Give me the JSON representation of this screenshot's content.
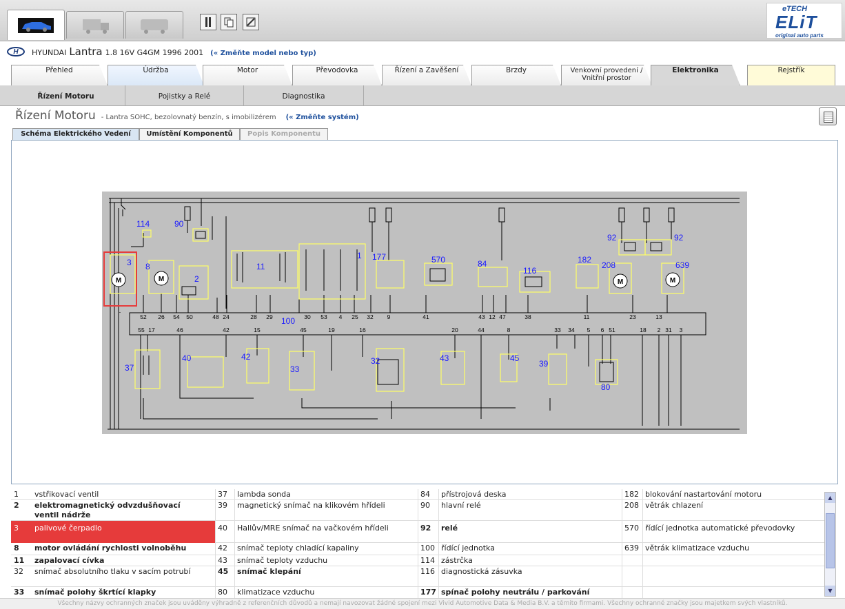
{
  "brand": {
    "top": "eTECH",
    "name": "ELiT",
    "tagline": "original auto parts"
  },
  "vehicle": {
    "make": "HYUNDAI",
    "model": "Lantra",
    "spec": "1.8 16V G4GM 1996 2001",
    "change_link": "(« Změňte model nebo typ)"
  },
  "main_tabs": [
    {
      "label": "Přehled"
    },
    {
      "label": "Údržba"
    },
    {
      "label": "Motor"
    },
    {
      "label": "Převodovka"
    },
    {
      "label": "Řízení a Zavěšení"
    },
    {
      "label": "Brzdy"
    },
    {
      "label": "Venkovní provedení / Vnitřní prostor"
    },
    {
      "label": "Elektronika"
    },
    {
      "label": "Rejstřík"
    }
  ],
  "sub_tabs": [
    {
      "label": "Řízení Motoru"
    },
    {
      "label": "Pojistky a Relé"
    },
    {
      "label": "Diagnostika"
    }
  ],
  "system": {
    "title": "Řízení Motoru",
    "desc": "- Lantra SOHC, bezolovnatý benzín, s imobilizérem",
    "change_link": "(« Změňte systém)"
  },
  "inner_tabs": [
    {
      "label": "Schéma Elektrického Vedení"
    },
    {
      "label": "Umístění Komponentů"
    },
    {
      "label": "Popis Komponentu"
    }
  ],
  "diagram_labels": {
    "c114": "114",
    "c90": "90",
    "c3": "3",
    "c8": "8",
    "c2": "2",
    "c11": "11",
    "c1": "1",
    "c177": "177",
    "c570": "570",
    "c84": "84",
    "c116": "116",
    "c182": "182",
    "c92a": "92",
    "c92b": "92",
    "c208": "208",
    "c639": "639",
    "c100": "100",
    "c37": "37",
    "c40": "40",
    "c42": "42",
    "c33": "33",
    "c32": "32",
    "c43": "43",
    "c45": "45",
    "c39": "39",
    "c80": "80"
  },
  "pins": {
    "p52": "52",
    "p26": "26",
    "p54": "54",
    "p50": "50",
    "p48": "48",
    "p24": "24",
    "p28": "28",
    "p29": "29",
    "p30": "30",
    "p53": "53",
    "p4": "4",
    "p25": "25",
    "p32": "32",
    "p9": "9",
    "p41": "41",
    "p43": "43",
    "p12": "12",
    "p47": "47",
    "p38": "38",
    "p11": "11",
    "p23": "23",
    "p13": "13",
    "q55": "55",
    "q17": "17",
    "q46": "46",
    "q42": "42",
    "q15": "15",
    "q45": "45",
    "q19": "19",
    "q16": "16",
    "q20": "20",
    "q44": "44",
    "q8": "8",
    "q33": "33",
    "q34": "34",
    "q5": "5",
    "q6": "6",
    "q51": "51",
    "q18": "18",
    "q2": "2",
    "q31": "31",
    "q3": "3"
  },
  "legend": [
    {
      "c1n": "1",
      "c1t": "vstřikovací ventil",
      "c2n": "37",
      "c2t": "lambda sonda",
      "c3n": "84",
      "c3t": "přístrojová deska",
      "c4n": "182",
      "c4t": "blokování nastartování motoru"
    },
    {
      "c1n": "2",
      "c1t": "elektromagnetický odvzdušňovací ventil nádrže",
      "c2n": "39",
      "c2t": "magnetický snímač na klikovém hřídeli",
      "c3n": "90",
      "c3t": "hlavní relé",
      "c4n": "208",
      "c4t": "větrák chlazení"
    },
    {
      "c1n": "3",
      "c1t": "palivové čerpadlo",
      "c2n": "40",
      "c2t": "Hallův/MRE snímač na vačkovém hřídeli",
      "c3n": "92",
      "c3t": "relé",
      "c4n": "570",
      "c4t": "řídící jednotka automatické převodovky"
    },
    {
      "c1n": "8",
      "c1t": "motor ovládání rychlosti volnoběhu",
      "c2n": "42",
      "c2t": "snímač teploty chladící kapaliny",
      "c3n": "100",
      "c3t": "řídící jednotka",
      "c4n": "639",
      "c4t": "větrák klimatizace vzduchu"
    },
    {
      "c1n": "11",
      "c1t": "zapalovací cívka",
      "c2n": "43",
      "c2t": "snímač teploty vzduchu",
      "c3n": "114",
      "c3t": "zástrčka",
      "c4n": "",
      "c4t": ""
    },
    {
      "c1n": "32",
      "c1t": "snímač absolutního tlaku v sacím potrubí",
      "c2n": "45",
      "c2t": "snímač klepání",
      "c3n": "116",
      "c3t": "diagnostická zásuvka",
      "c4n": "",
      "c4t": ""
    },
    {
      "c1n": "33",
      "c1t": "snímač polohy škrtící klapky",
      "c2n": "80",
      "c2t": "klimatizace vzduchu",
      "c3n": "177",
      "c3t": "spínač polohy neutrálu / parkování",
      "c4n": "",
      "c4t": ""
    }
  ],
  "footer": "Všechny názvy ochranných značek jsou uváděny výhradně z referenčních důvodů a nemají navozovat žádné spojení mezi Vivid Automotive Data & Media B.V. a těmito firmami. Všechny ochranné značky jsou majetkem svých vlastníků.",
  "colors": {
    "highlight": "#e63b3b",
    "label_blue": "#1a1aff",
    "component_yellow": "#ffff66"
  }
}
